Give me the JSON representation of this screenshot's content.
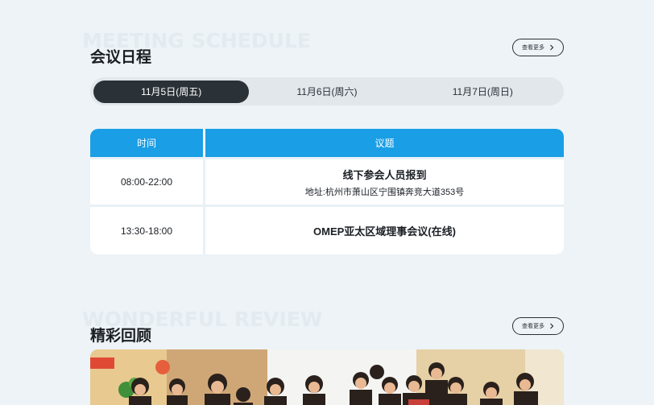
{
  "schedule": {
    "ghost_title": "MEETING SCHEDULE",
    "title": "会议日程",
    "more_label": "查看更多",
    "tabs": [
      {
        "label": "11月5日(周五)",
        "active": true
      },
      {
        "label": "11月6日(周六)",
        "active": false
      },
      {
        "label": "11月7日(周日)",
        "active": false
      }
    ],
    "table": {
      "headers": [
        "时间",
        "议题"
      ],
      "rows": [
        {
          "time": "08:00-22:00",
          "topic": "线下参会人员报到",
          "address": "地址:杭州市萧山区宁围镇奔竞大道353号"
        },
        {
          "time": "13:30-18:00",
          "topic": "OMEP亚太区域理事会议(在线)",
          "address": ""
        }
      ]
    }
  },
  "review": {
    "ghost_title": "WONDERFUL REVIEW",
    "title": "精彩回顾",
    "more_label": "查看更多"
  },
  "colors": {
    "page_bg": "#edf3f7",
    "accent_blue": "#1a9ee6",
    "active_tab": "#2a3137"
  }
}
